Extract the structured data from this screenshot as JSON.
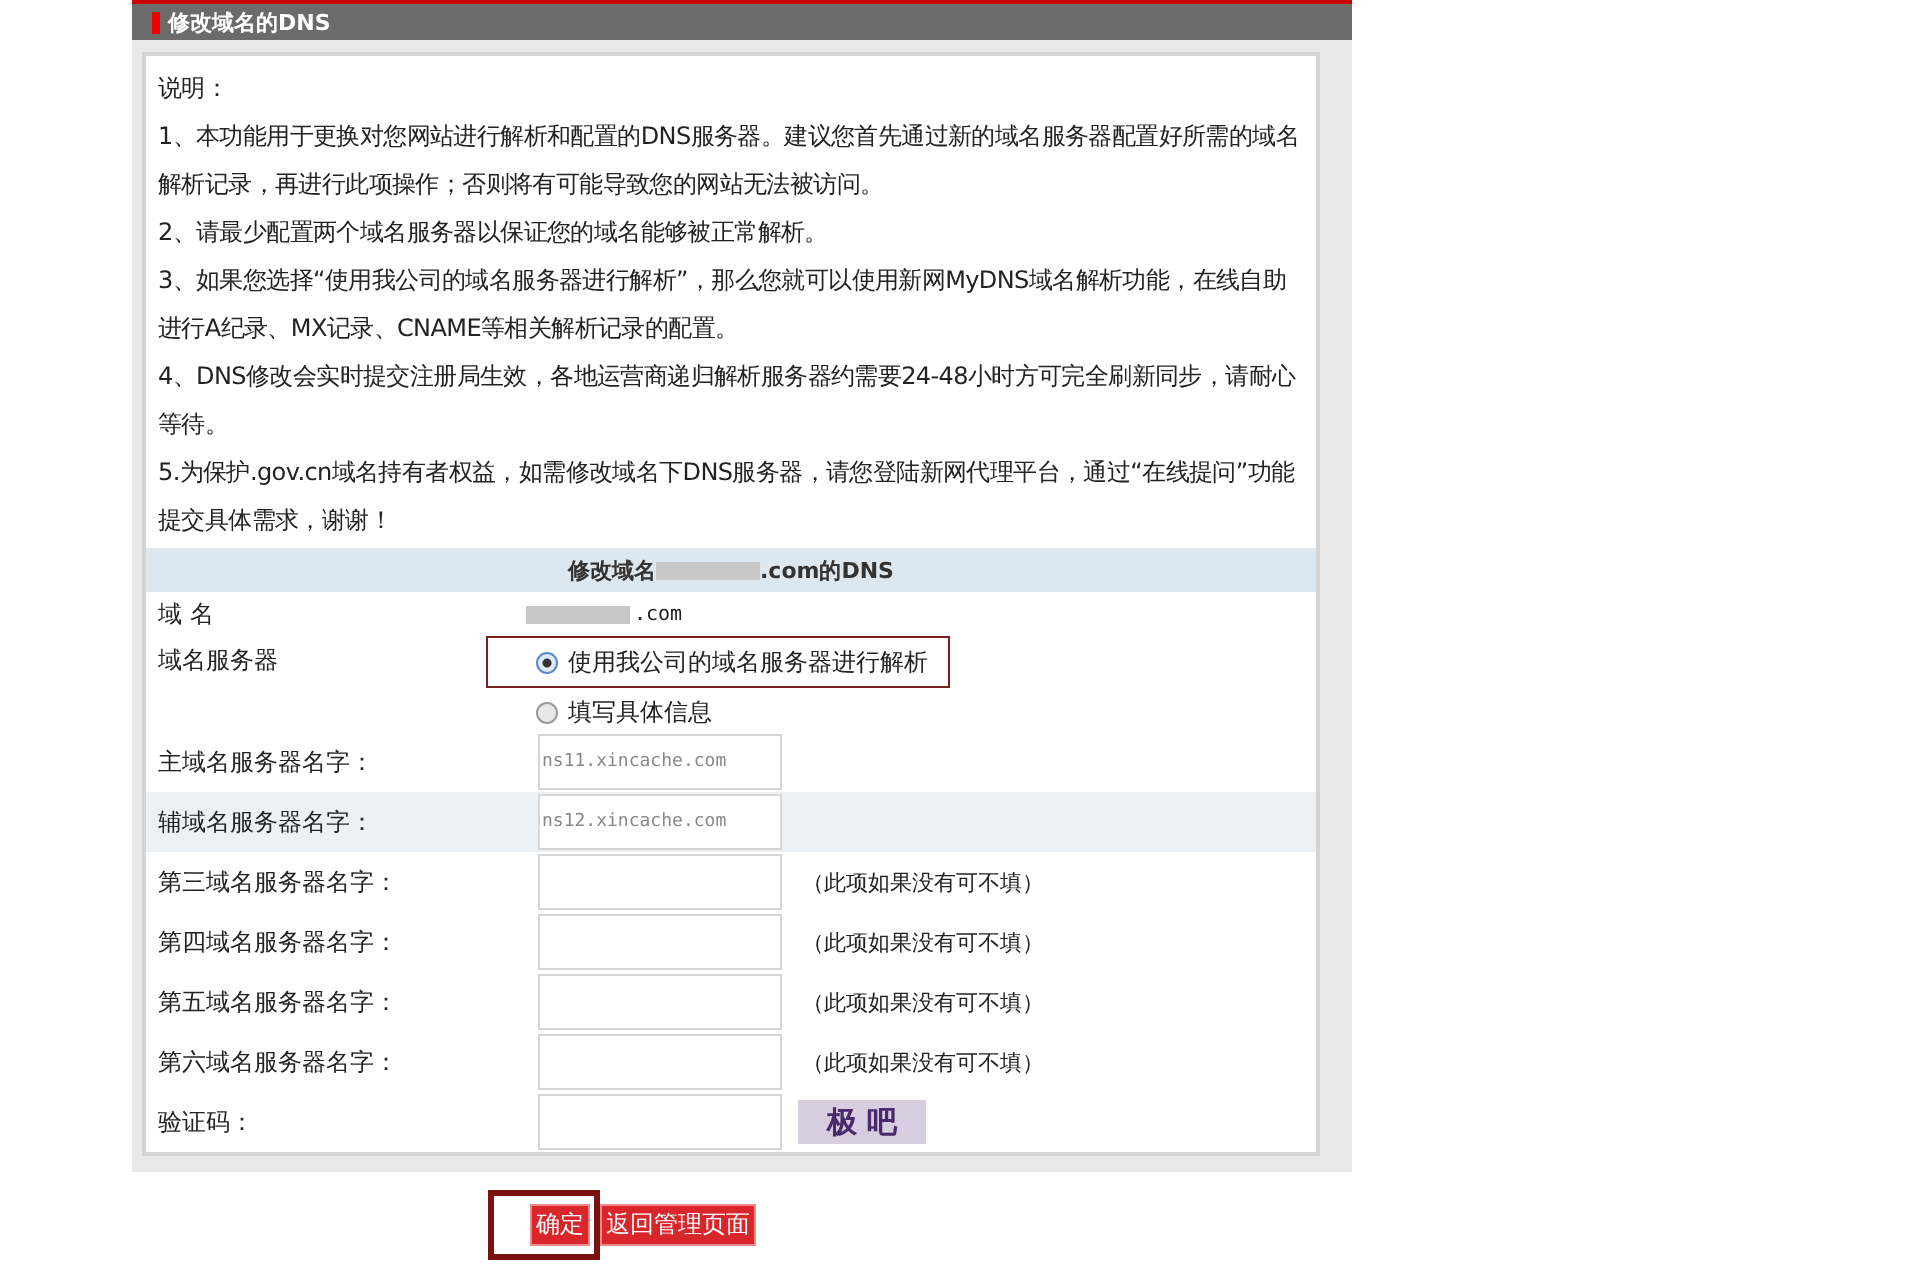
{
  "panel": {
    "title": "修改域名的DNS"
  },
  "notes": {
    "heading": "说明：",
    "items": [
      "1、本功能用于更换对您网站进行解析和配置的DNS服务器。建议您首先通过新的域名服务器配置好所需的域名解析记录，再进行此项操作；否则将有可能导致您的网站无法被访问。",
      "2、请最少配置两个域名服务器以保证您的域名能够被正常解析。",
      "3、如果您选择“使用我公司的域名服务器进行解析”，那么您就可以使用新网MyDNS域名解析功能，在线自助进行A纪录、MX记录、CNAME等相关解析记录的配置。",
      "4、DNS修改会实时提交注册局生效，各地运营商递归解析服务器约需要24-48小时方可完全刷新同步，请耐心等待。",
      "5.为保护.gov.cn域名持有者权益，如需修改域名下DNS服务器，请您登陆新网代理平台，通过“在线提问”功能提交具体需求，谢谢！"
    ]
  },
  "form": {
    "title_prefix": "修改域名",
    "title_suffix": ".com的DNS",
    "domain": {
      "label": "域 名",
      "value": ".com"
    },
    "dns_server": {
      "label": "域名服务器",
      "options": [
        {
          "label": "使用我公司的域名服务器进行解析",
          "selected": true,
          "highlighted": true
        },
        {
          "label": "填写具体信息",
          "selected": false,
          "highlighted": false
        }
      ]
    },
    "fields": [
      {
        "label": "主域名服务器名字：",
        "placeholder": "ns11.xincache.com",
        "shaded": false
      },
      {
        "label": "辅域名服务器名字：",
        "placeholder": "ns12.xincache.com",
        "shaded": true
      },
      {
        "label": "第三域名服务器名字：",
        "note": "（此项如果没有可不填）",
        "shaded": false
      },
      {
        "label": "第四域名服务器名字：",
        "note": "（此项如果没有可不填）",
        "shaded": false
      },
      {
        "label": "第五域名服务器名字：",
        "note": "（此项如果没有可不填）",
        "shaded": false
      },
      {
        "label": "第六域名服务器名字：",
        "note": "（此项如果没有可不填）",
        "shaded": false
      }
    ],
    "captcha": {
      "label": "验证码：",
      "image_text": "极 吧"
    }
  },
  "buttons": [
    {
      "label": "确定",
      "highlighted": true
    },
    {
      "label": "返回管理页面",
      "highlighted": false
    }
  ]
}
